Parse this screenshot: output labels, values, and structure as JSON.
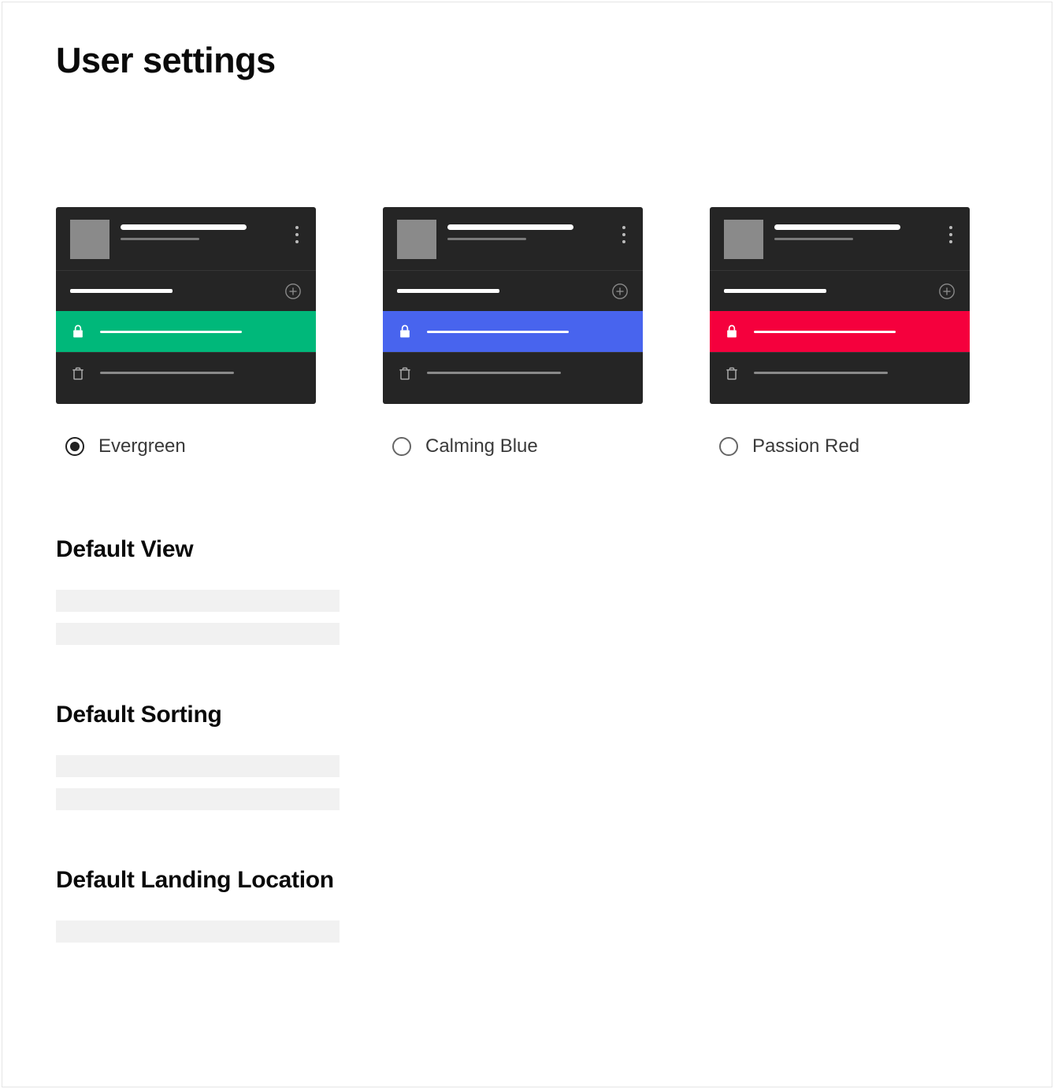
{
  "page": {
    "title": "User settings"
  },
  "themes": {
    "options": [
      {
        "id": "evergreen",
        "label": "Evergreen",
        "accent": "#00b87a",
        "selected": true
      },
      {
        "id": "calming-blue",
        "label": "Calming Blue",
        "accent": "#4864ee",
        "selected": false
      },
      {
        "id": "passion-red",
        "label": "Passion Red",
        "accent": "#f5003d",
        "selected": false
      }
    ]
  },
  "sections": {
    "defaultView": {
      "heading": "Default View",
      "skeletonCount": 2
    },
    "defaultSorting": {
      "heading": "Default Sorting",
      "skeletonCount": 2
    },
    "defaultLanding": {
      "heading": "Default Landing Location",
      "skeletonCount": 1
    }
  }
}
